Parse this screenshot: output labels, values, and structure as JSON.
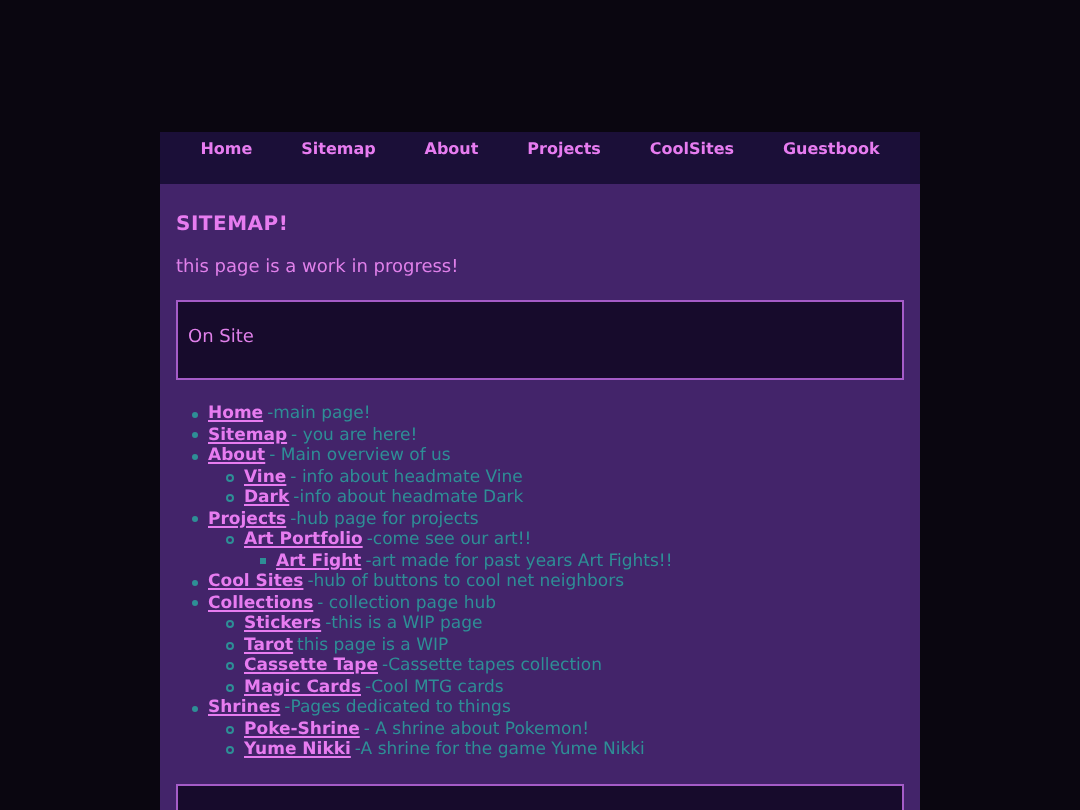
{
  "nav": [
    "Home",
    "Sitemap",
    "About",
    "Projects",
    "CoolSites",
    "Guestbook"
  ],
  "title": "SITEMAP!",
  "intro": "this page is a work in progress!",
  "section_heading": "On Site",
  "sitemap": [
    {
      "link": "Home",
      "description": "-main page!"
    },
    {
      "link": "Sitemap",
      "description": "- you are here!"
    },
    {
      "link": "About",
      "description": "- Main overview of us",
      "children": [
        {
          "link": "Vine",
          "description": "- info about headmate Vine"
        },
        {
          "link": "Dark",
          "description": "-info about headmate Dark"
        }
      ]
    },
    {
      "link": "Projects",
      "description": "-hub page for projects",
      "children": [
        {
          "link": "Art Portfolio",
          "description": "-come see our art!!",
          "children": [
            {
              "link": "Art Fight",
              "description": "-art made for past years Art Fights!!"
            }
          ]
        }
      ]
    },
    {
      "link": "Cool Sites",
      "description": "-hub of buttons to cool net neighbors"
    },
    {
      "link": "Collections",
      "description": "- collection page hub",
      "children": [
        {
          "link": "Stickers",
          "description": "-this is a WIP page"
        },
        {
          "link": "Tarot",
          "description": "this page is a WIP"
        },
        {
          "link": "Cassette Tape",
          "description": "-Cassette tapes collection"
        },
        {
          "link": "Magic Cards",
          "description": "-Cool MTG cards"
        }
      ]
    },
    {
      "link": "Shrines",
      "description": "-Pages dedicated to things",
      "children": [
        {
          "link": "Poke-Shrine",
          "description": "- A shrine about Pokemon!"
        },
        {
          "link": "Yume Nikki",
          "description": "-A shrine for the game Yume Nikki"
        }
      ]
    }
  ]
}
